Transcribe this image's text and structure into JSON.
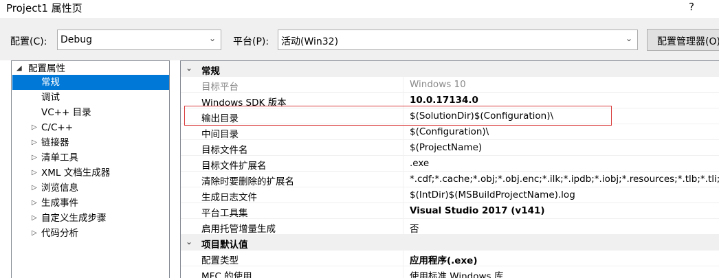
{
  "window": {
    "title": "Project1 属性页",
    "help": "?"
  },
  "toolbar": {
    "config_label": "配置(C):",
    "config_value": "Debug",
    "platform_label": "平台(P):",
    "platform_value": "活动(Win32)",
    "manager_button": "配置管理器(O)..."
  },
  "tree": {
    "root": "配置属性",
    "items": [
      "常规",
      "调试",
      "VC++ 目录",
      "C/C++",
      "链接器",
      "清单工具",
      "XML 文档生成器",
      "浏览信息",
      "生成事件",
      "自定义生成步骤",
      "代码分析"
    ],
    "selected": "常规"
  },
  "grid": {
    "sections": [
      {
        "title": "常规",
        "rows": [
          {
            "name": "目标平台",
            "value": "Windows 10"
          },
          {
            "name": "Windows SDK 版本",
            "value": "10.0.17134.0"
          },
          {
            "name": "输出目录",
            "value": "$(SolutionDir)$(Configuration)\\"
          },
          {
            "name": "中间目录",
            "value": "$(Configuration)\\"
          },
          {
            "name": "目标文件名",
            "value": "$(ProjectName)"
          },
          {
            "name": "目标文件扩展名",
            "value": ".exe"
          },
          {
            "name": "清除时要删除的扩展名",
            "value": "*.cdf;*.cache;*.obj;*.obj.enc;*.ilk;*.ipdb;*.iobj;*.resources;*.tlb;*.tli;*.t"
          },
          {
            "name": "生成日志文件",
            "value": "$(IntDir)$(MSBuildProjectName).log"
          },
          {
            "name": "平台工具集",
            "value": "Visual Studio 2017 (v141)"
          },
          {
            "name": "启用托管增量生成",
            "value": "否"
          }
        ]
      },
      {
        "title": "项目默认值",
        "rows": [
          {
            "name": "配置类型",
            "value": "应用程序(.exe)"
          },
          {
            "name": "MFC 的使用",
            "value": "使用标准 Windows 库"
          }
        ]
      }
    ]
  },
  "colors": {
    "selection": "#0078d7",
    "highlight_box": "#d93a3a",
    "category_bg": "#f0f0f0"
  }
}
